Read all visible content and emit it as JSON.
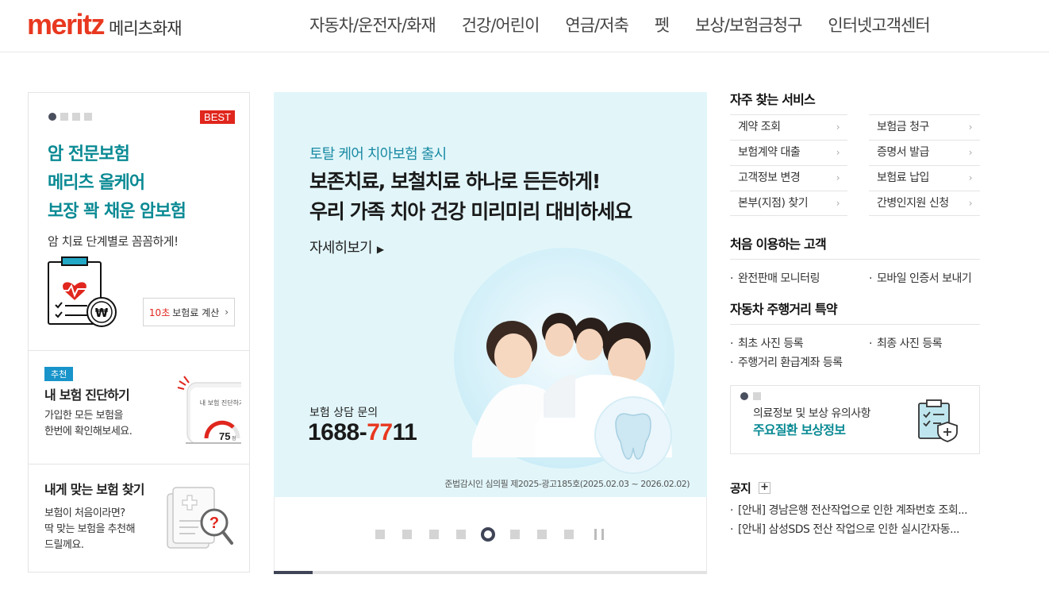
{
  "header": {
    "logo_word": "meritz",
    "logo_kr": "메리츠화재",
    "nav": [
      "자동차/운전자/화재",
      "건강/어린이",
      "연금/저축",
      "펫",
      "보상/보험금청구",
      "인터넷고객센터"
    ]
  },
  "promo": {
    "badge": "BEST",
    "title_lines": [
      "암 전문보험",
      "메리츠 올케어",
      "보장 꽉 채운 암보험"
    ],
    "subtitle": "암 치료 단계별로 꼼꼼하게!",
    "calc_red": "10초",
    "calc_label": "보험료 계산",
    "calc_chev": "›"
  },
  "diagnosis": {
    "tag": "추천",
    "title": "내 보험 진단하기",
    "text_lines": [
      "가입한 모든 보험을",
      "한번에 확인해보세요."
    ],
    "phone_label": "내 보험 진단하기",
    "score": "75",
    "score_unit": "점"
  },
  "find": {
    "title": "내게 맞는 보험 찾기",
    "text_lines": [
      "보험이 처음이라면?",
      "딱 맞는 보험을 추천해",
      "드릴께요."
    ]
  },
  "banner": {
    "kicker": "토탈 케어 치아보험 출시",
    "headline_lines": [
      "보존치료, 보철치료 하나로 든든하게!",
      "우리 가족 치아 건강 미리미리 대비하세요"
    ],
    "more": "자세히보기",
    "more_tri": "▶",
    "phone_label": "보험 상담 문의",
    "phone_a": "1688-",
    "phone_b": "77",
    "phone_c": "11",
    "legal": "준법감시인 심의필 제2025-광고185호(2025.02.03 ~ 2026.02.02)",
    "slide_count": 8,
    "active_slide": 5,
    "progress": 0.09
  },
  "services": {
    "title": "자주 찾는 서비스",
    "col1": [
      "계약 조회",
      "보험계약 대출",
      "고객정보 변경",
      "본부(지점) 찾기"
    ],
    "col2": [
      "보험금 청구",
      "증명서 발급",
      "보험료 납입",
      "간병인지원 신청"
    ],
    "chev": "›"
  },
  "first_customer": {
    "title": "처음 이용하는 고객",
    "items": [
      "완전판매 모니터링",
      "모바일 인증서 보내기"
    ]
  },
  "car_mileage": {
    "title": "자동차 주행거리 특약",
    "items": [
      "최초 사진 등록",
      "최종 사진 등록",
      "주행거리 환급계좌 등록"
    ]
  },
  "info_box": {
    "line1": "의료정보 및 보상 유의사항",
    "line2": "주요질환 보상정보"
  },
  "notice": {
    "title": "공지",
    "plus": "+",
    "items": [
      "[안내] 경남은행 전산작업으로 인한 계좌번호 조회...",
      "[안내] 삼성SDS 전산 작업으로 인한 실시간자동..."
    ]
  },
  "colors": {
    "brand_red": "#e8381f",
    "teal": "#0a8a94",
    "banner_bg": "#e2f6fa",
    "dark_indicator": "#3f4457"
  }
}
